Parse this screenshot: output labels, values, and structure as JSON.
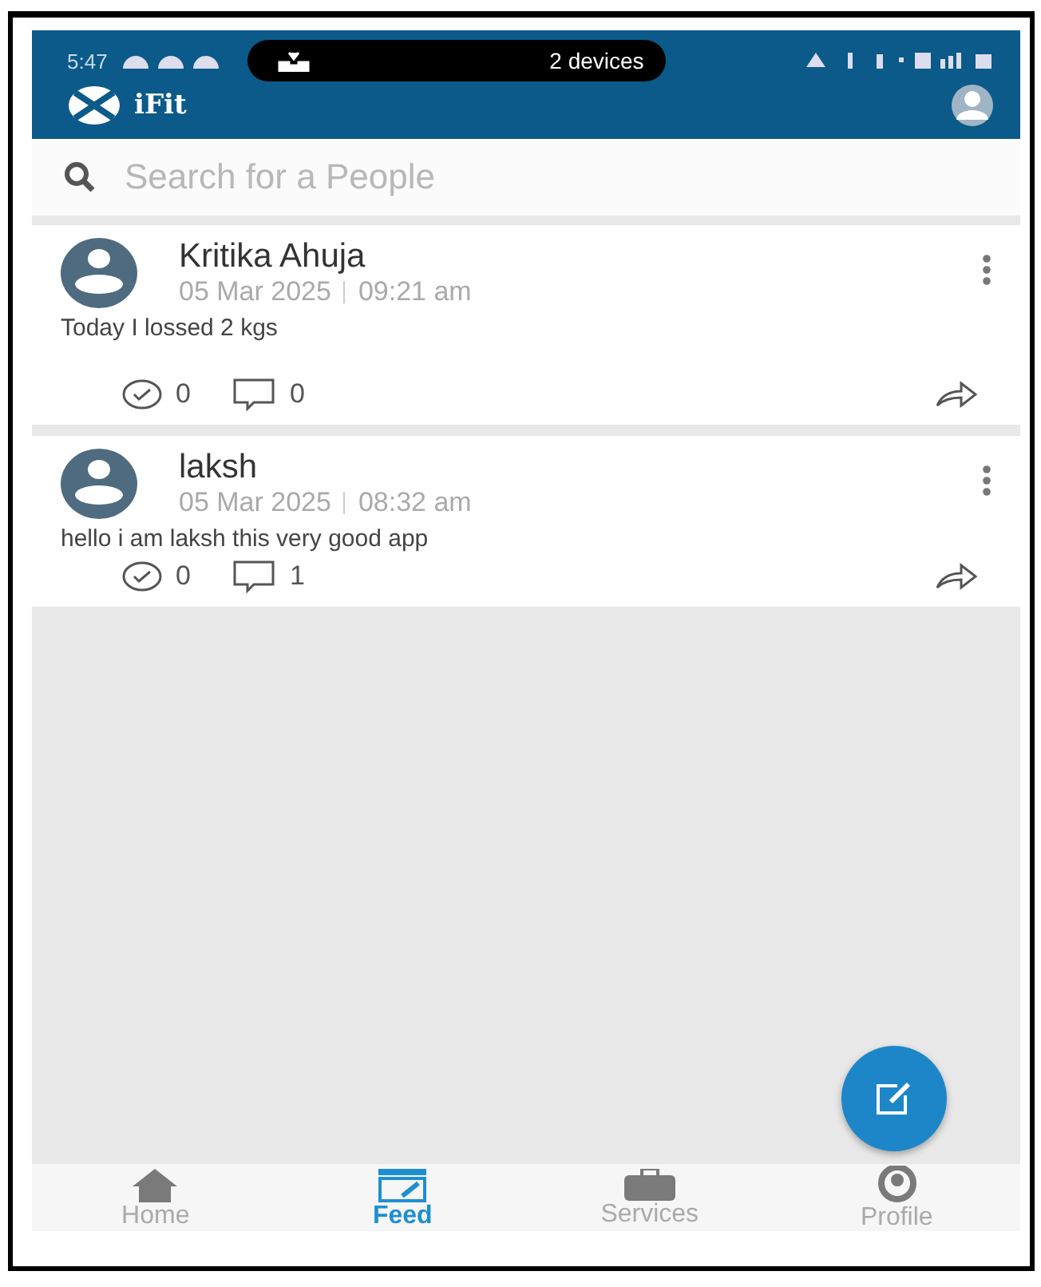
{
  "status_bar": {
    "time": "5:47",
    "pill_text": "2 devices"
  },
  "app_bar": {
    "title": "iFit"
  },
  "search": {
    "placeholder": "Search for a People"
  },
  "posts": [
    {
      "author": "Kritika Ahuja",
      "date": "05 Mar 2025",
      "time": "09:21 am",
      "text": "Today I lossed 2 kgs",
      "likes": "0",
      "comments": "0"
    },
    {
      "author": "laksh",
      "date": "05 Mar 2025",
      "time": "08:32 am",
      "text": "hello i am laksh this very good app",
      "likes": "0",
      "comments": "1"
    }
  ],
  "tabs": [
    {
      "label": "Home",
      "kind": "home",
      "selected": false
    },
    {
      "label": "Feed",
      "kind": "feed",
      "selected": true
    },
    {
      "label": "Services",
      "kind": "services",
      "selected": false
    },
    {
      "label": "Profile",
      "kind": "profile",
      "selected": false
    }
  ]
}
